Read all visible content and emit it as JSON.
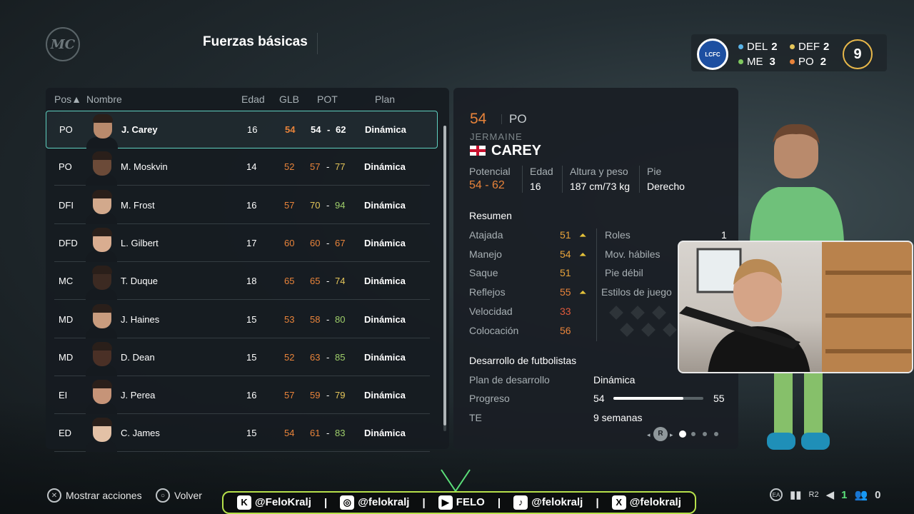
{
  "header": {
    "logo": "MC",
    "title": "Fuerzas básicas"
  },
  "squad": {
    "del_label": "DEL",
    "del": "2",
    "def_label": "DEF",
    "def": "2",
    "me_label": "ME",
    "me": "3",
    "po_label": "PO",
    "po": "2",
    "total": "9",
    "colors": {
      "del": "#5ab4e8",
      "def": "#e5c65a",
      "me": "#7fc85f",
      "po": "#e8833a"
    }
  },
  "table": {
    "headers": {
      "pos": "Pos▲",
      "name": "Nombre",
      "age": "Edad",
      "glb": "GLB",
      "pot": "POT",
      "plan": "Plan"
    },
    "rows": [
      {
        "pos": "PO",
        "name": "J. Carey",
        "age": "16",
        "glb": "54",
        "pot_min": "54",
        "pot_max": "62",
        "plan": "Dinámica",
        "skin": "#b98a6c"
      },
      {
        "pos": "PO",
        "name": "M. Moskvin",
        "age": "14",
        "glb": "52",
        "pot_min": "57",
        "pot_max": "77",
        "plan": "Dinámica",
        "skin": "#6b4a38"
      },
      {
        "pos": "DFI",
        "name": "M. Frost",
        "age": "16",
        "glb": "57",
        "pot_min": "70",
        "pot_max": "94",
        "plan": "Dinámica",
        "skin": "#d2a98c"
      },
      {
        "pos": "DFD",
        "name": "L. Gilbert",
        "age": "17",
        "glb": "60",
        "pot_min": "60",
        "pot_max": "67",
        "plan": "Dinámica",
        "skin": "#d9ad90"
      },
      {
        "pos": "MC",
        "name": "T. Duque",
        "age": "18",
        "glb": "65",
        "pot_min": "65",
        "pot_max": "74",
        "plan": "Dinámica",
        "skin": "#3c2a22"
      },
      {
        "pos": "MD",
        "name": "J. Haines",
        "age": "15",
        "glb": "53",
        "pot_min": "58",
        "pot_max": "80",
        "plan": "Dinámica",
        "skin": "#c99c7e"
      },
      {
        "pos": "MD",
        "name": "D. Dean",
        "age": "15",
        "glb": "52",
        "pot_min": "63",
        "pot_max": "85",
        "plan": "Dinámica",
        "skin": "#4a3026"
      },
      {
        "pos": "EI",
        "name": "J. Perea",
        "age": "16",
        "glb": "57",
        "pot_min": "59",
        "pot_max": "79",
        "plan": "Dinámica",
        "skin": "#c69478"
      },
      {
        "pos": "ED",
        "name": "C. James",
        "age": "15",
        "glb": "54",
        "pot_min": "61",
        "pot_max": "83",
        "plan": "Dinámica",
        "skin": "#e3c1a6"
      }
    ]
  },
  "detail": {
    "rating": "54",
    "pos": "PO",
    "first_name": "JERMAINE",
    "last_name": "CAREY",
    "potential_label": "Potencial",
    "potential": "54 - 62",
    "age_label": "Edad",
    "age": "16",
    "hw_label": "Altura y peso",
    "hw": "187 cm/73 kg",
    "foot_label": "Pie",
    "foot": "Derecho",
    "summary_label": "Resumen",
    "attrs": [
      {
        "name": "Atajada",
        "value": "51"
      },
      {
        "name": "Manejo",
        "value": "54"
      },
      {
        "name": "Saque",
        "value": "51"
      },
      {
        "name": "Reflejos",
        "value": "55"
      },
      {
        "name": "Velocidad",
        "value": "33"
      },
      {
        "name": "Colocación",
        "value": "56"
      }
    ],
    "roles_label": "Roles",
    "roles": "1",
    "skills_label": "Mov. hábiles",
    "weak_label": "Pie débil",
    "styles_label": "Estilos de juego",
    "dev_label": "Desarrollo de futbolistas",
    "plan_label": "Plan de desarrollo",
    "plan": "Dinámica",
    "progress_label": "Progreso",
    "progress_from": "54",
    "progress_to": "55",
    "progress_fraction": 0.78,
    "te_label": "TE",
    "te": "9 semanas",
    "page_button": "R"
  },
  "footer": {
    "actions": "Mostrar acciones",
    "back": "Volver",
    "counter1": "1",
    "counter2": "0"
  },
  "social": {
    "kick": "@FeloKralj",
    "instagram": "@felokralj",
    "youtube": "FELO",
    "tiktok": "@felokralj",
    "x": "@felokralj"
  }
}
